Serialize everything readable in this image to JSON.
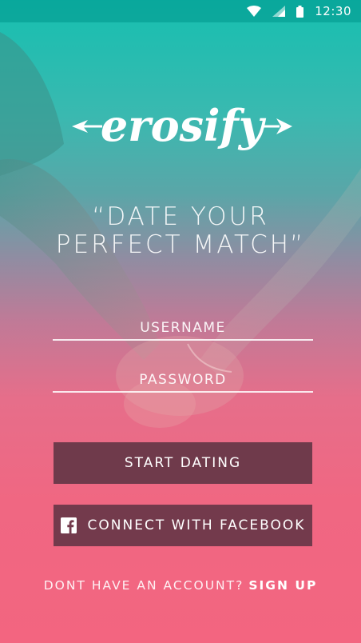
{
  "status_bar": {
    "time": "12:30",
    "icons": [
      "wifi-icon",
      "signal-icon",
      "battery-icon"
    ]
  },
  "brand": {
    "logo_text": "erosify",
    "accent_top": "#16bfb0",
    "accent_bottom": "#f36580"
  },
  "tagline": {
    "line1": "“DATE YOUR",
    "line2": "PERFECT MATCH”"
  },
  "form": {
    "username_placeholder": "USERNAME",
    "username_value": "",
    "password_placeholder": "PASSWORD",
    "password_value": ""
  },
  "buttons": {
    "start_label": "START DATING",
    "facebook_label": "CONNECT WITH FACEBOOK",
    "button_color": "#6f3a4b"
  },
  "footer": {
    "prompt": "DONT HAVE AN ACCOUNT?",
    "signup_label": "SIGN UP"
  }
}
